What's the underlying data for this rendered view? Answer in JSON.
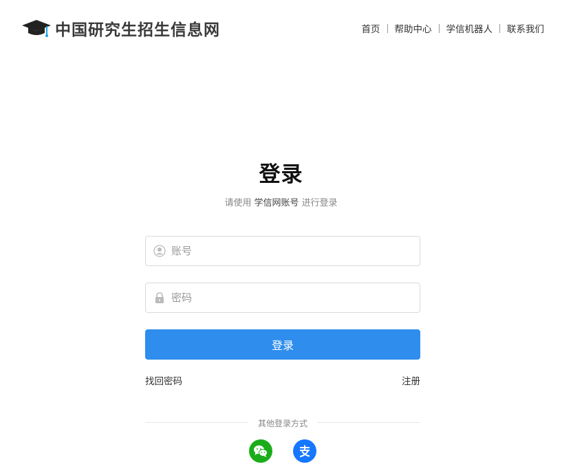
{
  "header": {
    "site_name": "中国研究生招生信息网",
    "nav": [
      {
        "label": "首页"
      },
      {
        "label": "帮助中心"
      },
      {
        "label": "学信机器人"
      },
      {
        "label": "联系我们"
      }
    ]
  },
  "login": {
    "title": "登录",
    "subtitle_prefix": "请使用",
    "subtitle_account": "学信网账号",
    "subtitle_suffix": "进行登录",
    "username_placeholder": "账号",
    "password_placeholder": "密码",
    "submit_label": "登录",
    "forgot_label": "找回密码",
    "register_label": "注册",
    "other_methods_label": "其他登录方式",
    "social": [
      {
        "icon": "wechat-icon",
        "color": "#1aad19"
      },
      {
        "icon": "alipay-icon",
        "color": "#1677ff"
      }
    ]
  },
  "colors": {
    "primary": "#2e8ded"
  }
}
